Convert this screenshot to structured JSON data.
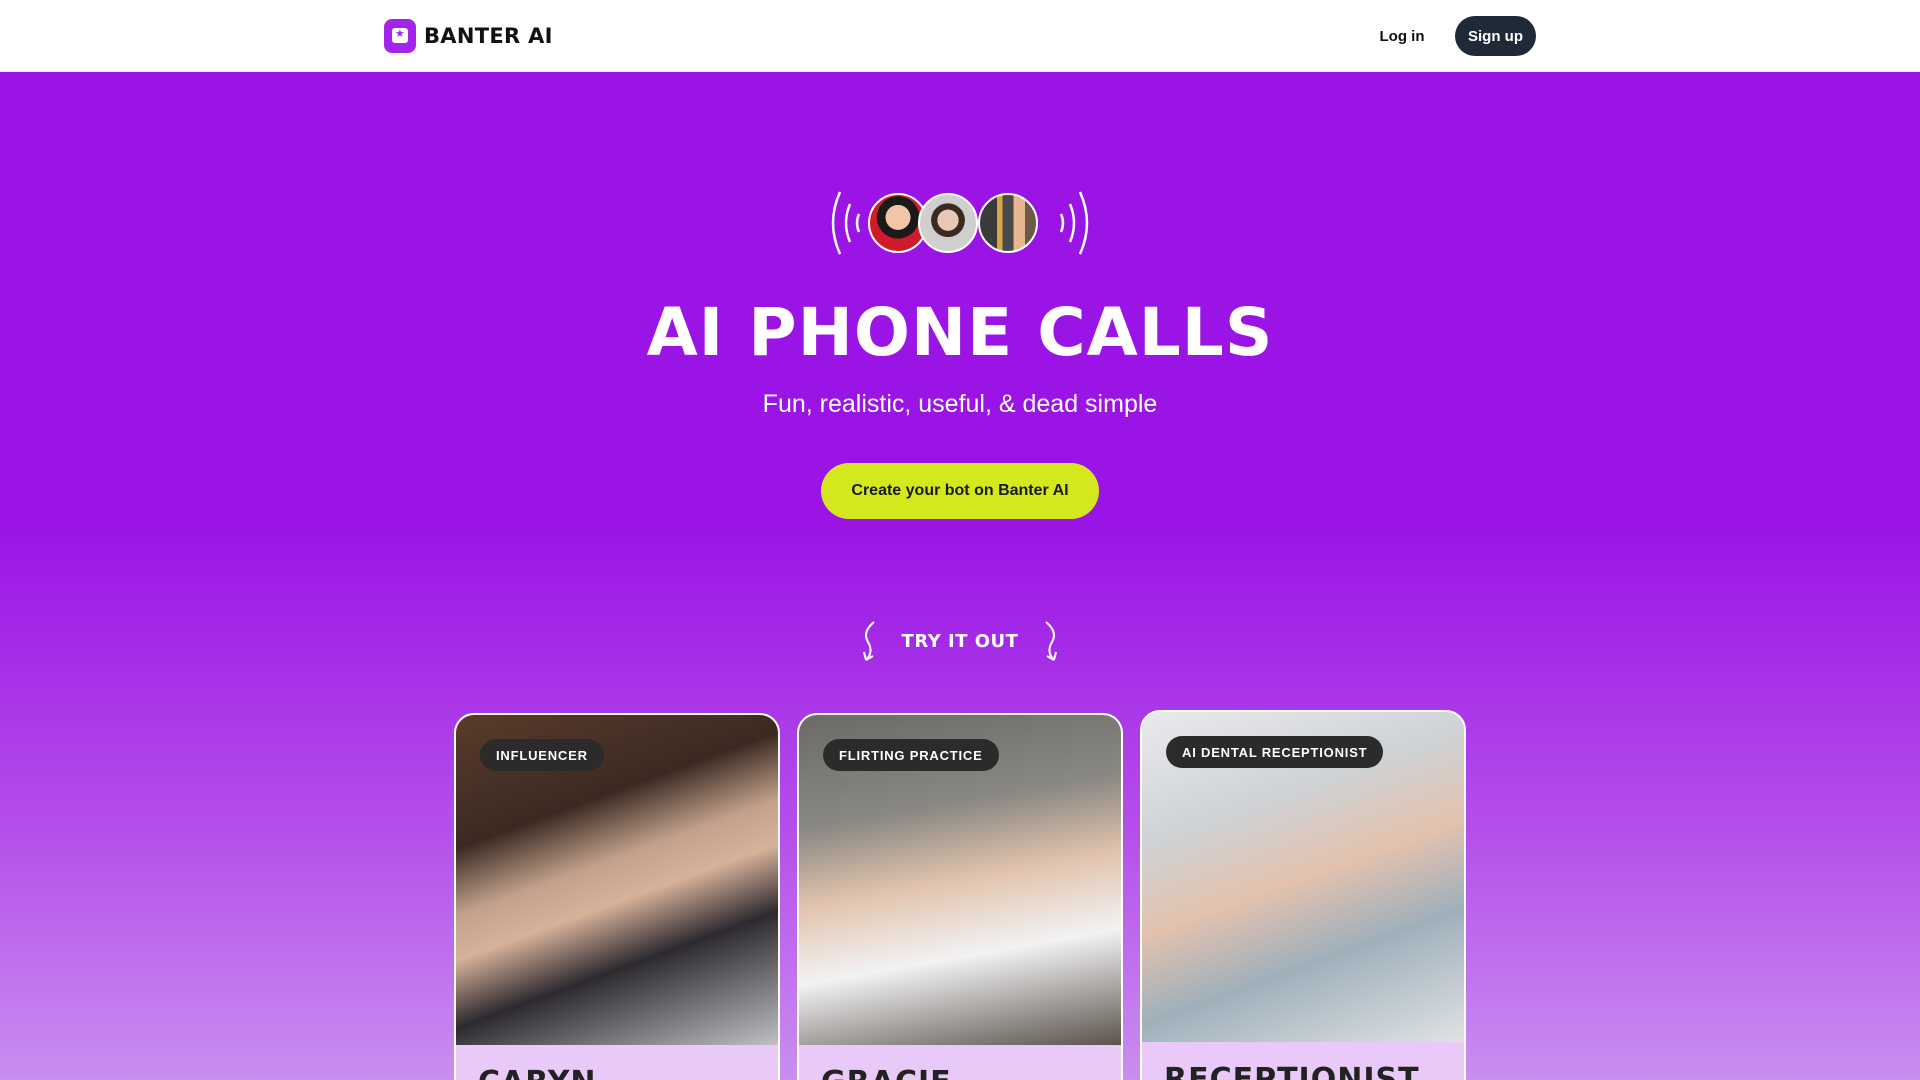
{
  "header": {
    "brand": "BANTER AI",
    "login_label": "Log in",
    "signup_label": "Sign up"
  },
  "hero": {
    "title": "AI PHONE CALLS",
    "subtitle": "Fun, realistic, useful, & dead simple",
    "cta_label": "Create your bot on Banter AI",
    "try_label": "TRY IT OUT"
  },
  "cards": [
    {
      "badge": "INFLUENCER",
      "name": "CARYN"
    },
    {
      "badge": "FLIRTING PRACTICE",
      "name": "GRACIE"
    },
    {
      "badge": "AI DENTAL RECEPTIONIST",
      "name": "RECEPTIONIST"
    }
  ],
  "colors": {
    "brand_purple": "#9b16e6",
    "cta_yellow": "#d4e81d",
    "signup_dark": "#1f2937"
  }
}
